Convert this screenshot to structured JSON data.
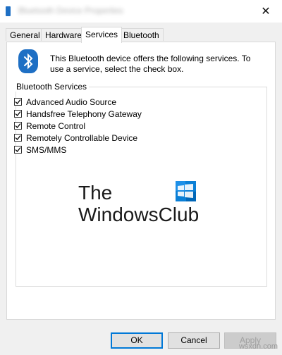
{
  "window": {
    "title": "Bluetooth Device Properties",
    "close_symbol": "✕"
  },
  "tabs": [
    {
      "label": "General",
      "active": false
    },
    {
      "label": "Hardware",
      "active": false
    },
    {
      "label": "Services",
      "active": true
    },
    {
      "label": "Bluetooth",
      "active": false
    }
  ],
  "services_page": {
    "description": "This Bluetooth device offers the following services. To use a service, select the check box.",
    "group_title": "Bluetooth Services",
    "icon": "bluetooth-icon",
    "services": [
      {
        "label": "Advanced Audio Source",
        "checked": true
      },
      {
        "label": "Handsfree Telephony Gateway",
        "checked": true
      },
      {
        "label": "Remote Control",
        "checked": true
      },
      {
        "label": "Remotely Controllable Device",
        "checked": true
      },
      {
        "label": "SMS/MMS",
        "checked": true
      }
    ]
  },
  "logo": {
    "line1": "The",
    "line2": "WindowsClub"
  },
  "buttons": {
    "ok": "OK",
    "cancel": "Cancel",
    "apply": "Apply"
  },
  "watermark": "wsxdn.com",
  "colors": {
    "accent": "#0078d7",
    "bluetooth": "#1e6fc4"
  }
}
